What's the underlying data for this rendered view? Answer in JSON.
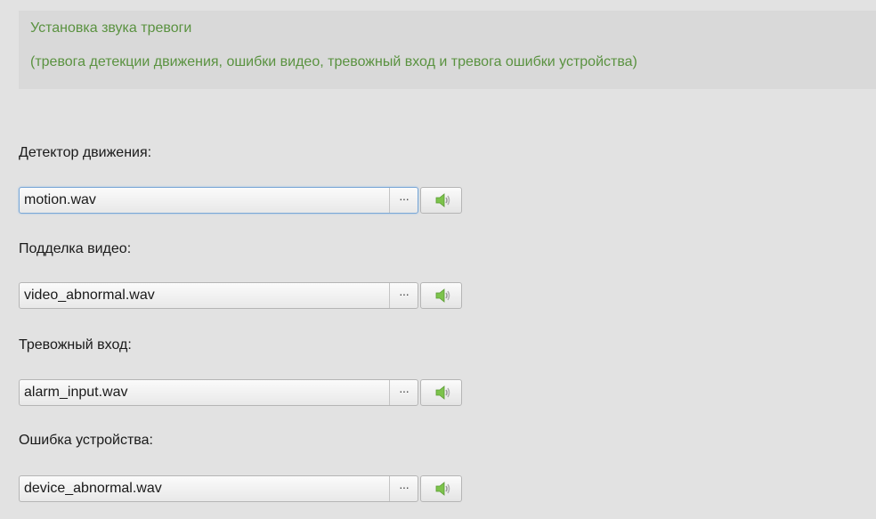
{
  "header": {
    "title": "Установка звука тревоги",
    "description": "(тревога детекции движения, ошибки видео, тревожный вход и тревога ошибки устройства)"
  },
  "fields": [
    {
      "label": "Детектор движения:",
      "value": "motion.wav",
      "browse_label": "···",
      "play_icon": "speaker-icon"
    },
    {
      "label": "Подделка видео:",
      "value": "video_abnormal.wav",
      "browse_label": "···",
      "play_icon": "speaker-icon"
    },
    {
      "label": "Тревожный вход:",
      "value": "alarm_input.wav",
      "browse_label": "···",
      "play_icon": "speaker-icon"
    },
    {
      "label": "Ошибка устройства:",
      "value": "device_abnormal.wav",
      "browse_label": "···",
      "play_icon": "speaker-icon"
    }
  ],
  "colors": {
    "accent_text": "#5a9240",
    "background": "#e2e2e2",
    "info_box": "#d9d9d9",
    "speaker_icon": "#7cc34b"
  }
}
